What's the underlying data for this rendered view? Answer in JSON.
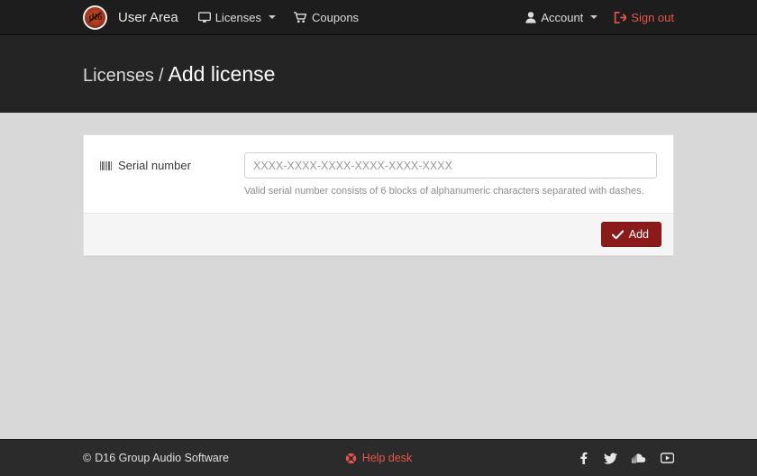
{
  "navbar": {
    "logo_icon": "d16-logo-icon",
    "logo_mark": "d16",
    "brand": "User Area",
    "items": [
      {
        "label": "Licenses",
        "icon": "desktop-icon",
        "has_caret": true
      },
      {
        "label": "Coupons",
        "icon": "shopping-cart-icon",
        "has_caret": false
      }
    ],
    "right_items": [
      {
        "label": "Account",
        "icon": "user-icon",
        "has_caret": true,
        "color": "#dcdcdc"
      },
      {
        "label": "Sign out",
        "icon": "sign-out-icon",
        "has_caret": false,
        "color": "#e8544c"
      }
    ]
  },
  "page_header": {
    "parent": "Licenses",
    "separator": "/",
    "current": "Add license"
  },
  "form": {
    "label": "Serial number",
    "label_icon": "barcode-icon",
    "input_value": "",
    "input_placeholder": "XXXX-XXXX-XXXX-XXXX-XXXX-XXXX",
    "help_text": "Valid serial number consists of 6 blocks of alphanumeric characters separated with dashes.",
    "submit_label": "Add",
    "submit_icon": "check-icon",
    "submit_color": "#8b1a1a"
  },
  "footer": {
    "copyright_symbol": "©",
    "copyright": "D16 Group Audio Software",
    "helpdesk_label": "Help desk",
    "helpdesk_icon": "life-ring-icon",
    "helpdesk_color": "#e8544c",
    "socials": [
      {
        "name": "facebook-icon"
      },
      {
        "name": "twitter-icon"
      },
      {
        "name": "soundcloud-icon"
      },
      {
        "name": "youtube-icon"
      }
    ]
  },
  "colors": {
    "navbar_bg": "#1d1d1d",
    "header_bg": "#242424",
    "content_bg": "#d8d8d8",
    "card_bg": "#ffffff",
    "card_footer_bg": "#f5f5f5",
    "footer_bg": "#2b2b2b",
    "accent_red": "#e8544c",
    "button_red": "#8b1a1a"
  }
}
